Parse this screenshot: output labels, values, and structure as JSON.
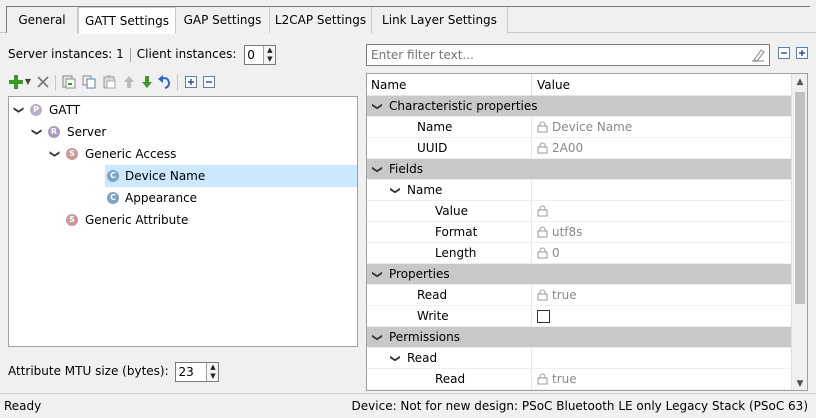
{
  "tabs": [
    {
      "label": "General",
      "active": false
    },
    {
      "label": "GATT Settings",
      "active": true
    },
    {
      "label": "GAP Settings",
      "active": false
    },
    {
      "label": "L2CAP Settings",
      "active": false
    },
    {
      "label": "Link Layer Settings",
      "active": false
    }
  ],
  "instances": {
    "server_label": "Server instances: 1",
    "client_label": "Client instances:",
    "client_value": "0"
  },
  "toolbar_icons": [
    "add-icon",
    "dropdown-arrow-icon",
    "delete-icon",
    "import-icon",
    "copy-icon",
    "paste-icon",
    "move-up-icon",
    "move-down-icon",
    "undo-icon",
    "expand-all-icon",
    "collapse-all-icon"
  ],
  "tree": [
    {
      "label": "GATT",
      "badge": "P",
      "level": 0,
      "expanded": true,
      "selected": false
    },
    {
      "label": "Server",
      "badge": "R",
      "level": 1,
      "expanded": true,
      "selected": false
    },
    {
      "label": "Generic Access",
      "badge": "S",
      "level": 2,
      "expanded": true,
      "selected": false
    },
    {
      "label": "Device Name",
      "badge": "C",
      "level": 3,
      "expanded": false,
      "selected": true
    },
    {
      "label": "Appearance",
      "badge": "C",
      "level": 3,
      "expanded": false,
      "selected": false
    },
    {
      "label": "Generic Attribute",
      "badge": "S",
      "level": 2,
      "expanded": false,
      "selected": false
    }
  ],
  "mtu": {
    "label": "Attribute MTU size (bytes):",
    "value": "23"
  },
  "filter": {
    "placeholder": "Enter filter text..."
  },
  "grid": {
    "headers": {
      "name": "Name",
      "value": "Value"
    },
    "rows": [
      {
        "name": "Characteristic properties",
        "value": "",
        "type": "category",
        "level": 0
      },
      {
        "name": "Name",
        "value": "Device Name",
        "type": "locked",
        "level": 1
      },
      {
        "name": "UUID",
        "value": "2A00",
        "type": "locked",
        "level": 1
      },
      {
        "name": "Fields",
        "value": "",
        "type": "category",
        "level": 0
      },
      {
        "name": "Name",
        "value": "",
        "type": "group",
        "level": 1
      },
      {
        "name": "Value",
        "value": "",
        "type": "locked",
        "level": 2
      },
      {
        "name": "Format",
        "value": "utf8s",
        "type": "locked",
        "level": 2
      },
      {
        "name": "Length",
        "value": "0",
        "type": "locked",
        "level": 2
      },
      {
        "name": "Properties",
        "value": "",
        "type": "category",
        "level": 0
      },
      {
        "name": "Read",
        "value": "true",
        "type": "locked",
        "level": 1
      },
      {
        "name": "Write",
        "value": "",
        "type": "checkbox",
        "level": 1
      },
      {
        "name": "Permissions",
        "value": "",
        "type": "category",
        "level": 0
      },
      {
        "name": "Read",
        "value": "",
        "type": "group",
        "level": 1
      },
      {
        "name": "Read",
        "value": "true",
        "type": "locked",
        "level": 2
      }
    ]
  },
  "status": {
    "left": "Ready",
    "right": "Device: Not for new design: PSoC Bluetooth LE only Legacy Stack (PSoC 63)"
  },
  "colors": {
    "selection": "#cce8ff",
    "category_row": "#c8c8c8",
    "add_icon": "#3a9a2a",
    "move_arrow": "#3a9a2a",
    "undo_icon": "#2a66c8"
  }
}
